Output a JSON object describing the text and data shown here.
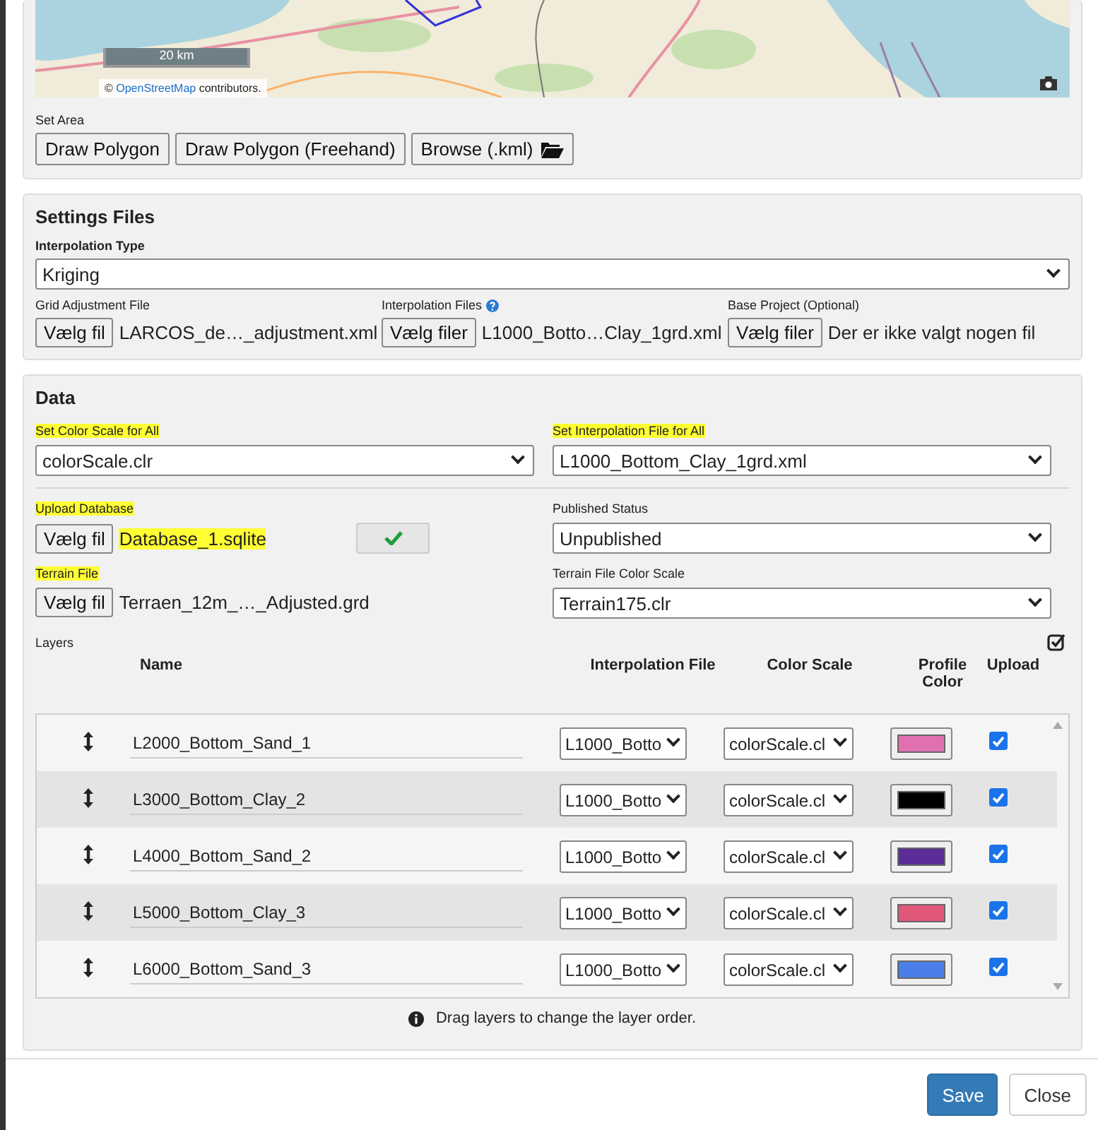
{
  "map": {
    "scale": "20 km",
    "attribution_prefix": "©",
    "attribution_link": "OpenStreetMap",
    "attribution_suffix": "contributors."
  },
  "set_area": {
    "label": "Set Area",
    "buttons": [
      {
        "label": "Draw Polygon",
        "kind": "plain"
      },
      {
        "label": "Draw Polygon (Freehand)",
        "kind": "plain"
      },
      {
        "label": "Browse (.kml)",
        "kind": "folder"
      }
    ]
  },
  "settings_files": {
    "title": "Settings Files",
    "interpolation_type": {
      "label": "Interpolation Type",
      "value": "Kriging"
    },
    "files": [
      {
        "label": "Grid Adjustment File",
        "help": false,
        "button": "Vælg fil",
        "file": "LARCOS_de…_adjustment.xml"
      },
      {
        "label": "Interpolation Files",
        "help": true,
        "button": "Vælg filer",
        "file": "L1000_Botto…Clay_1grd.xml"
      },
      {
        "label": "Base Project (Optional)",
        "help": false,
        "button": "Vælg filer",
        "file": "Der er ikke valgt nogen fil"
      }
    ]
  },
  "data": {
    "title": "Data",
    "color_scale_all": {
      "label": "Set Color Scale for All",
      "highlighted": true,
      "value": "colorScale.clr"
    },
    "interpolation_all": {
      "label": "Set Interpolation File for All",
      "highlighted": true,
      "value": "L1000_Bottom_Clay_1grd.xml"
    },
    "upload_database": {
      "label": "Upload Database",
      "highlighted": true,
      "button": "Vælg fil",
      "file": "Database_1.sqlite",
      "file_highlighted": true
    },
    "published_status": {
      "label": "Published Status",
      "highlighted": false,
      "value": "Unpublished"
    },
    "terrain_file": {
      "label": "Terrain File",
      "highlighted": true,
      "button": "Vælg fil",
      "file": "Terraen_12m_…_Adjusted.grd",
      "file_highlighted": false
    },
    "terrain_color_scale": {
      "label": "Terrain File Color Scale",
      "highlighted": false,
      "value": "Terrain175.clr"
    },
    "layers": {
      "label": "Layers",
      "columns": [
        "Name",
        "Interpolation File",
        "Color Scale",
        "Profile Color",
        "Upload"
      ],
      "rows": [
        {
          "name": "L2000_Bottom_Sand_1",
          "interpolation": "L1000_Botto",
          "color_scale": "colorScale.cl",
          "color": "#e070b0",
          "upload": true
        },
        {
          "name": "L3000_Bottom_Clay_2",
          "interpolation": "L1000_Botto",
          "color_scale": "colorScale.cl",
          "color": "#000000",
          "upload": true
        },
        {
          "name": "L4000_Bottom_Sand_2",
          "interpolation": "L1000_Botto",
          "color_scale": "colorScale.cl",
          "color": "#5b2d99",
          "upload": true
        },
        {
          "name": "L5000_Bottom_Clay_3",
          "interpolation": "L1000_Botto",
          "color_scale": "colorScale.cl",
          "color": "#e0577a",
          "upload": true
        },
        {
          "name": "L6000_Bottom_Sand_3",
          "interpolation": "L1000_Botto",
          "color_scale": "colorScale.cl",
          "color": "#4a7ee8",
          "upload": true
        }
      ],
      "hint": "Drag layers to change the layer order."
    }
  },
  "footer": {
    "buttons": [
      {
        "label": "Save",
        "kind": "primary"
      },
      {
        "label": "Close",
        "kind": "default"
      }
    ]
  }
}
